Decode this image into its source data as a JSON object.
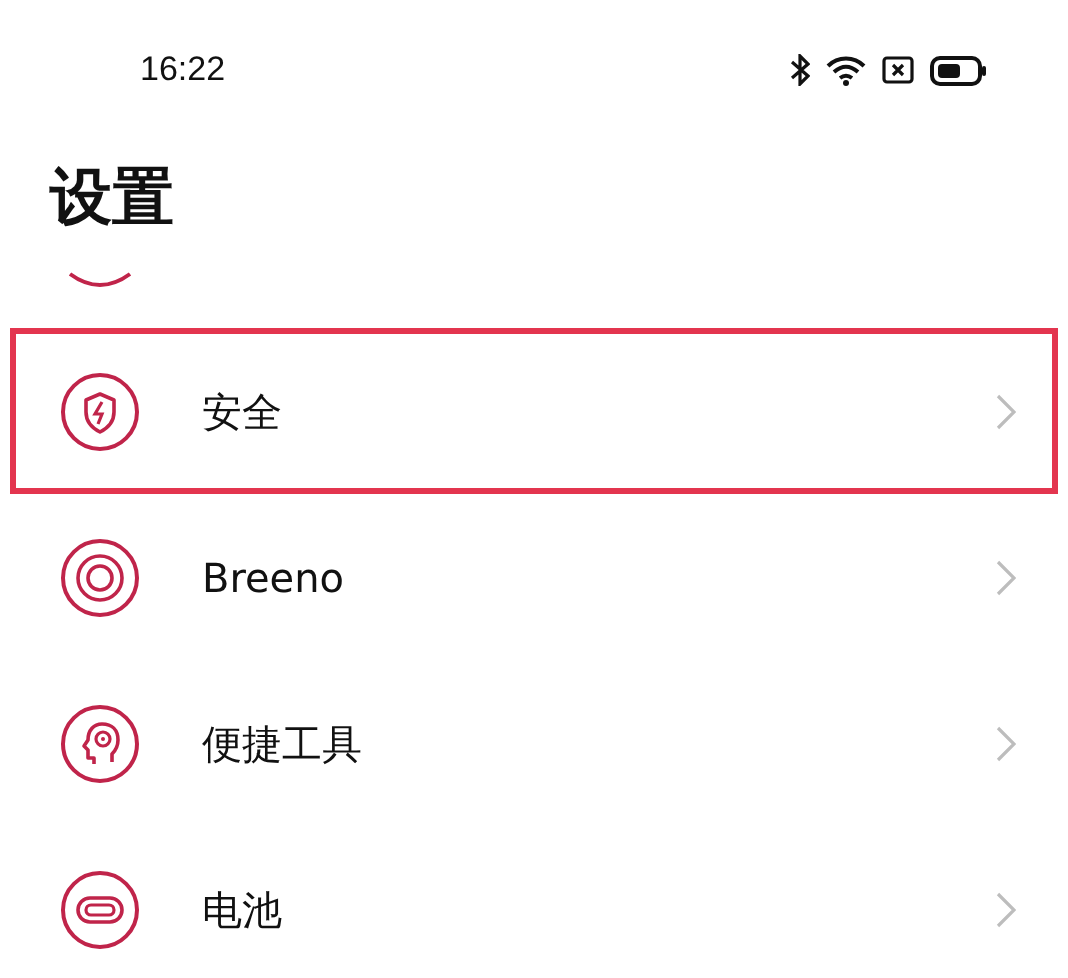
{
  "status_bar": {
    "time": "16:22"
  },
  "title": "设置",
  "items": [
    {
      "label": "安全",
      "highlighted": true
    },
    {
      "label": "Breeno",
      "highlighted": false
    },
    {
      "label": "便捷工具",
      "highlighted": false
    },
    {
      "label": "电池",
      "highlighted": false
    }
  ]
}
